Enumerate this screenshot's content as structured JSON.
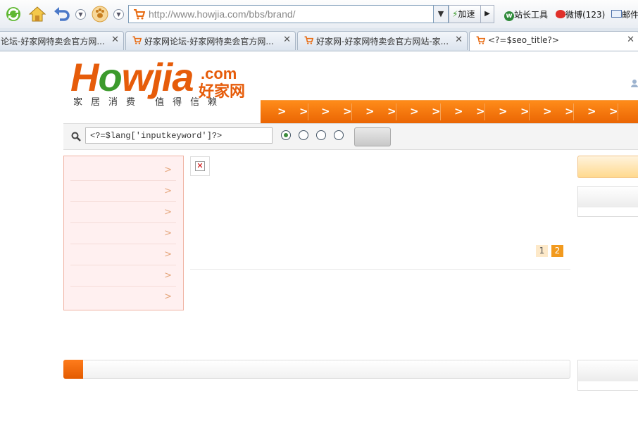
{
  "browser": {
    "address_url": "http://www.howjia.com/bbs/brand/",
    "speed_label": "加速",
    "toolbar_links": [
      "站长工具",
      "微博(123)",
      "邮件"
    ],
    "tabs": [
      {
        "title": "论坛-好家网特卖会官方网...",
        "active": false
      },
      {
        "title": "好家网论坛-好家网特卖会官方网...",
        "active": false
      },
      {
        "title": "好家网-好家网特卖会官方网站-家...",
        "active": false
      },
      {
        "title": "<?=$seo_title?>",
        "active": true
      }
    ]
  },
  "logo": {
    "brand": "Howjia",
    "com": ".com",
    "cn": "好家网",
    "slogan": "家居消费 值得信赖",
    "colors": {
      "orange": "#e65c0a",
      "green": "#3c9a2c"
    }
  },
  "nav": {
    "items": [
      ">",
      ">",
      ">",
      ">",
      ">",
      ">",
      ">",
      ">",
      ">",
      ">",
      ">",
      ">",
      ">",
      ">",
      ">",
      ">"
    ],
    "color": "#f07410"
  },
  "search": {
    "input_value": "<?=$lang['inputkeyword']?>",
    "radios": [
      true,
      false,
      false,
      false
    ]
  },
  "categories": {
    "items": [
      ">",
      ">",
      ">",
      ">",
      ">",
      ">",
      ">"
    ]
  },
  "pagination": {
    "pages": [
      "1",
      "2"
    ],
    "current": "2"
  }
}
